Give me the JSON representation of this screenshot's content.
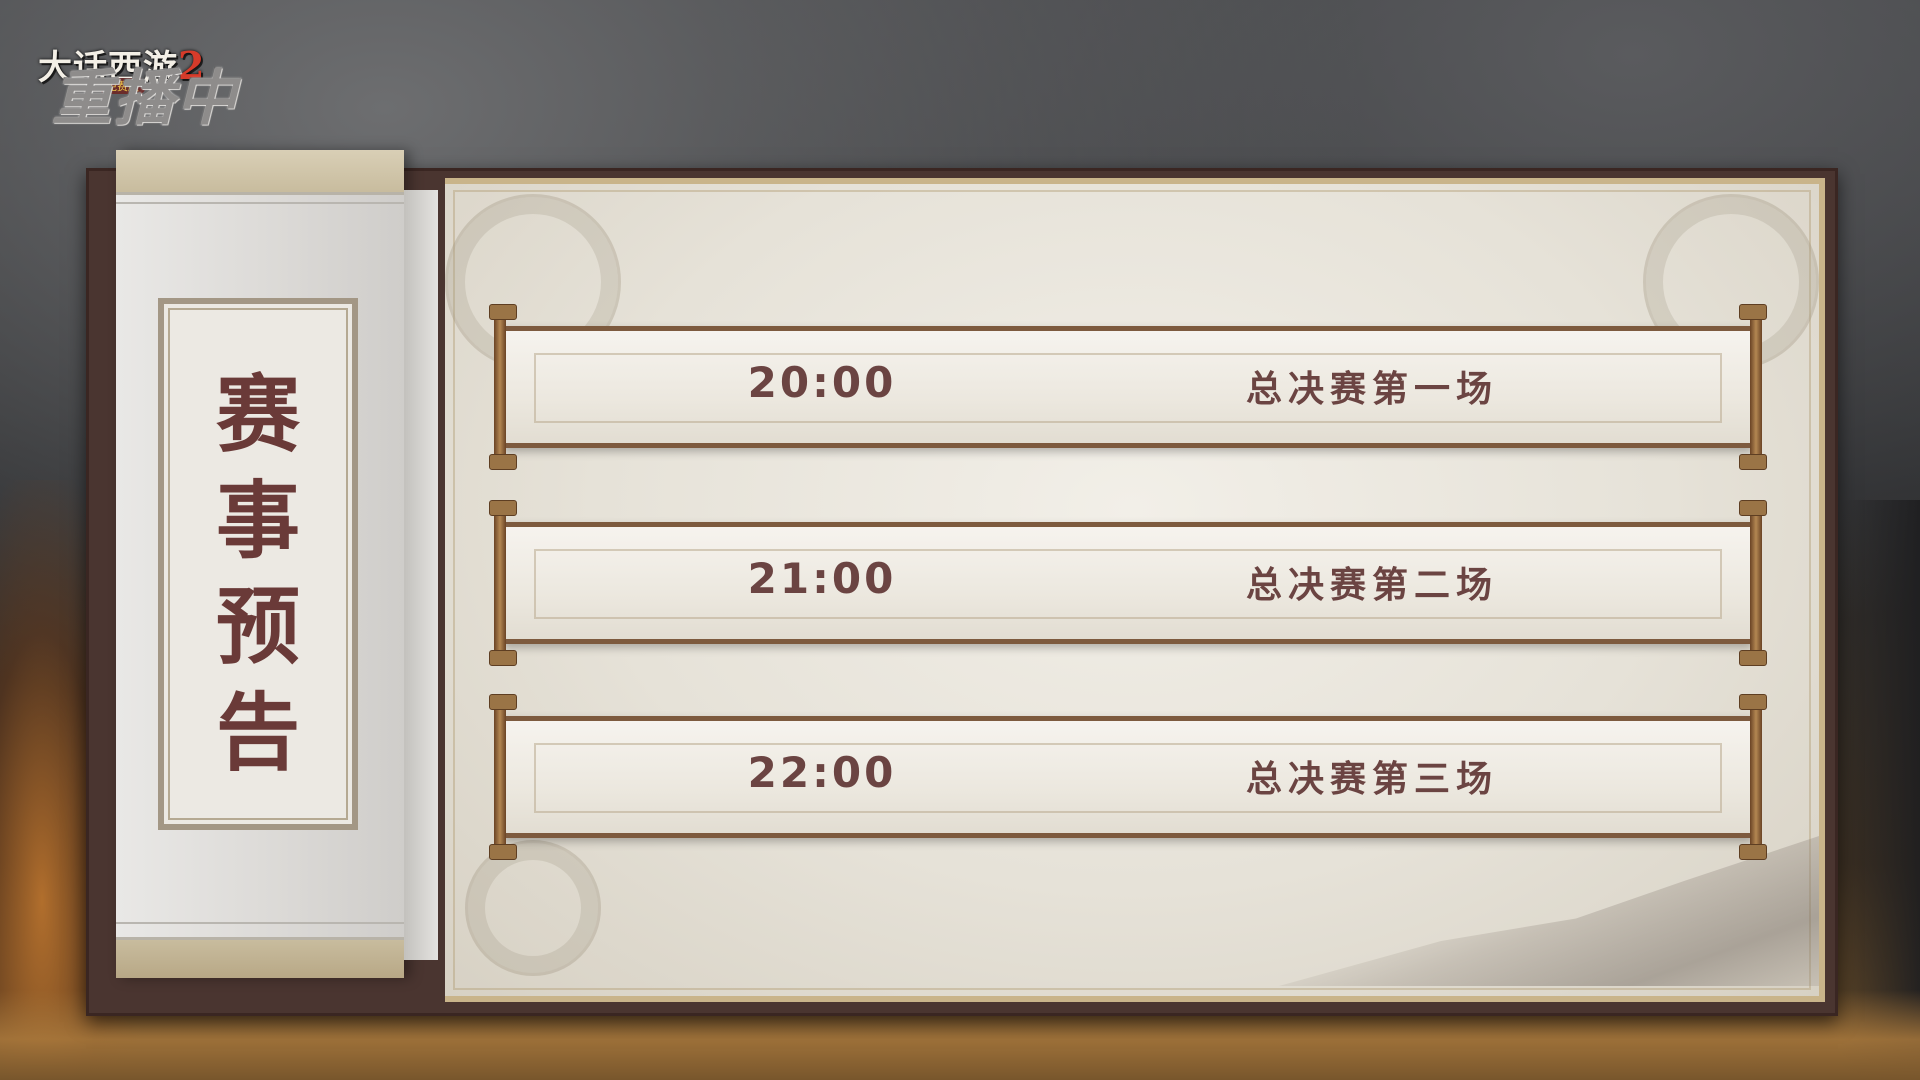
{
  "logo": {
    "title": "大话西游",
    "title_number": "2",
    "subtitle": "免费版",
    "status": "重播中"
  },
  "panel": {
    "title_chars": [
      "赛",
      "事",
      "预",
      "告"
    ]
  },
  "schedule": [
    {
      "time": "20:00",
      "match": "总决赛第一场"
    },
    {
      "time": "21:00",
      "match": "总决赛第二场"
    },
    {
      "time": "22:00",
      "match": "总决赛第三场"
    }
  ],
  "colors": {
    "text_primary": "#6b4442",
    "panel_frame": "#4a3530",
    "rod_wood": "#7d5a3e"
  }
}
